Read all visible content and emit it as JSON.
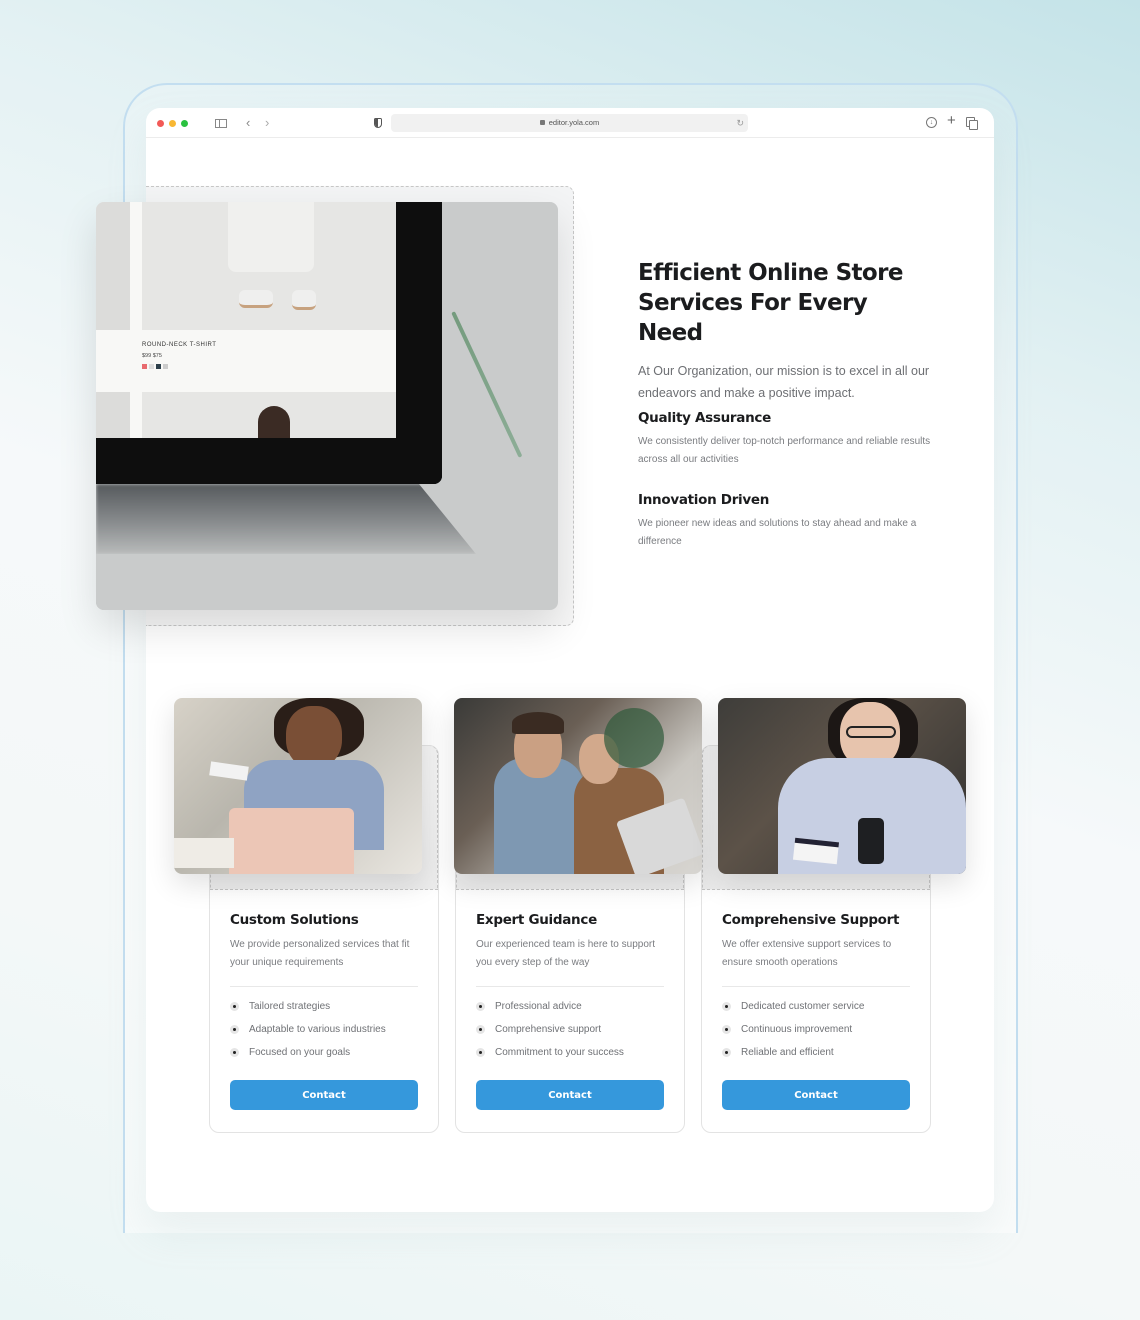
{
  "browser": {
    "url": "editor.yola.com",
    "icons": [
      "close-dot",
      "minimize-dot",
      "zoom-dot",
      "sidebar-icon",
      "back-icon",
      "forward-icon",
      "shield-icon",
      "lock-icon",
      "reload-icon",
      "download-icon",
      "plus-icon",
      "tabs-icon"
    ],
    "glyphs": {
      "back": "‹",
      "forward": "›",
      "reload": "↻",
      "plus": "+",
      "download": "↓"
    }
  },
  "hero": {
    "title_line1": "Efficient Online Store",
    "title_line2": "Services For Every Need",
    "subtitle": "At Our Organization, our mission is to excel in all our endeavors and make a positive impact.",
    "image_caption": "ROUND-NECK T-SHIRT",
    "image_price": "$99  $75",
    "features": [
      {
        "title": "Quality Assurance",
        "description": "We consistently deliver top-notch performance and reliable results across all our activities"
      },
      {
        "title": "Innovation Driven",
        "description": "We pioneer new ideas and solutions to stay ahead and make a difference"
      }
    ]
  },
  "cards": [
    {
      "title": "Custom Solutions",
      "description": "We provide personalized services that fit your unique requirements",
      "items": [
        "Tailored strategies",
        "Adaptable to various industries",
        "Focused on your goals"
      ],
      "button": "Contact"
    },
    {
      "title": "Expert Guidance",
      "description": "Our experienced team is here to support you every step of the way",
      "items": [
        "Professional advice",
        "Comprehensive support",
        "Commitment to your success"
      ],
      "button": "Contact"
    },
    {
      "title": "Comprehensive Support",
      "description": "We offer extensive support services to ensure smooth operations",
      "items": [
        "Dedicated customer service",
        "Continuous improvement",
        "Reliable and efficient"
      ],
      "button": "Contact"
    }
  ],
  "colors": {
    "accent": "#3598dc",
    "heading": "#1b1c1e",
    "body_text": "#7a7c80",
    "traffic_red": "#f25a57",
    "traffic_yellow": "#f8b733",
    "traffic_green": "#2ac140"
  }
}
